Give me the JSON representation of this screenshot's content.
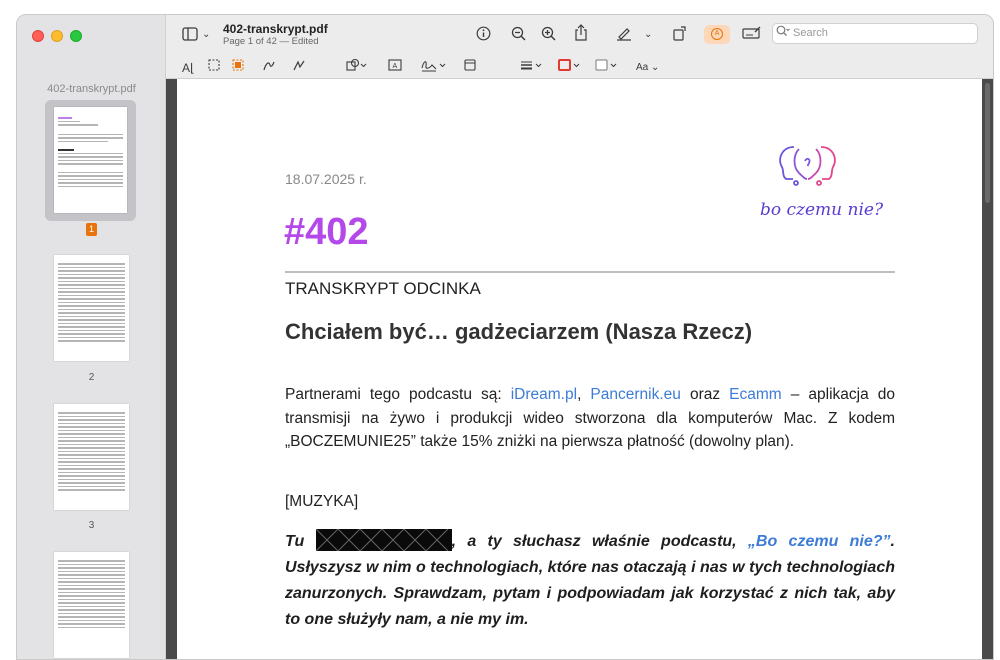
{
  "window": {
    "file_name": "402-transkrypt.pdf",
    "subtitle": "Page 1 of 42 — Edited",
    "search_placeholder": "Search"
  },
  "sidebar": {
    "title": "402-transkrypt.pdf",
    "pages": [
      {
        "label": "1",
        "selected": true
      },
      {
        "label": "2",
        "selected": false
      },
      {
        "label": "3",
        "selected": false
      }
    ]
  },
  "toolbar": {
    "icons": [
      "sidebar-icon",
      "chevron-down-icon",
      "info-icon",
      "zoom-out-icon",
      "zoom-in-icon",
      "share-icon",
      "highlight-pen-icon",
      "chevron-down-icon",
      "rotate-icon",
      "markup-icon",
      "form-icon",
      "search-icon"
    ],
    "markup_icons": [
      "text-selection-icon",
      "rect-selection-icon",
      "redact-icon",
      "sketch-icon",
      "draw-icon",
      "shapes-icon",
      "text-box-icon",
      "sign-icon",
      "note-icon",
      "line-style-icon",
      "border-color-icon",
      "fill-color-icon",
      "font-icon"
    ],
    "font_label": "Aa",
    "accent_color": "#e8730c"
  },
  "document": {
    "date": "18.07.2025 r.",
    "episode": "#402",
    "section_label": "TRANSKRYPT ODCINKA",
    "title": "Chciałem być… gadżeciarzem (Nasza Rzecz)",
    "partners_intro": "Partnerami tego podcastu są: ",
    "partner1": "iDream.pl",
    "sep1": ", ",
    "partner2": "Pancernik.eu",
    "sep2": " oraz ",
    "partner3": "Ecamm",
    "partners_rest": " – aplikacja do transmisji na żywo i produkcji wideo stworzona dla komputerów Mac. Z kodem „BOCZEMUNIE25” także 15% zniżki na pierwsza płatność (dowolny plan).",
    "music": "[MUZYKA]",
    "quote_start": "Tu ",
    "quote_mid": ", a ty słuchasz właśnie podcastu, ",
    "quote_podcast": "„Bo czemu nie?”",
    "quote_rest": ". Usłyszysz w nim o technologiach, które nas otaczają i nas w tych technologiach zanurzonych. Sprawdzam, pytam i podpowiadam jak korzystać z nich tak, aby to one służyły nam, a nie my im.",
    "logo_text": "bo czemu nie?",
    "episode_color": "#b548e8",
    "link_color": "#3d7bd6"
  }
}
